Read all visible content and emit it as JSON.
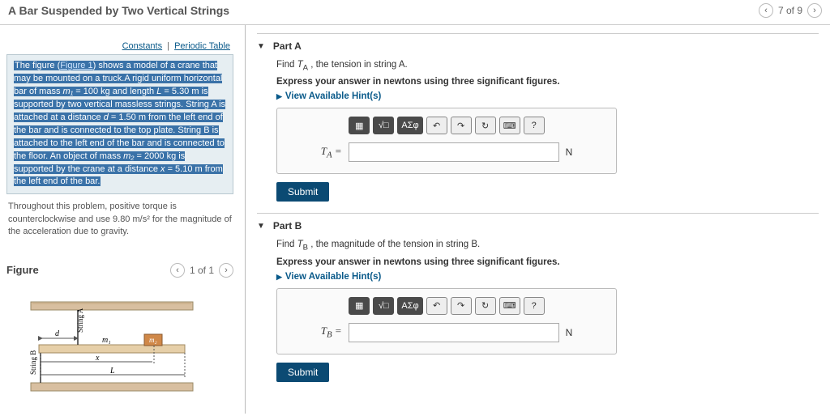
{
  "header": {
    "title": "A Bar Suspended by Two Vertical Strings",
    "pager": "7 of 9"
  },
  "left": {
    "links": {
      "constants": "Constants",
      "periodic": "Periodic Table"
    },
    "problem": {
      "pre": "The figure (",
      "figlink": "Figure 1",
      "t1a": ") shows a model of a crane that may be mounted on a truck.A rigid uniform horizontal bar of mass ",
      "m1sym": "m₁",
      "t1b": " = 100 kg and length ",
      "Lsym": "L",
      "t1c": " = 5.30 m is supported by two vertical massless strings. String A is attached at a distance ",
      "dsym": "d",
      "t1d": " = 1.50 m from the left end of the bar and is connected to the top plate. String B is attached to the left end of the bar and is connected to the floor. An object of mass ",
      "m2sym": "m₂",
      "t1e": " = 2000 kg is supported by the crane at a distance ",
      "xsym": "x",
      "t1f": " = 5.10 m from the left end of the bar."
    },
    "note": "Throughout this problem, positive torque is counterclockwise and use 9.80 m/s² for the magnitude of the acceleration due to gravity.",
    "figure": {
      "heading": "Figure",
      "pager": "1 of 1",
      "labels": {
        "stringA": "String A",
        "stringB": "String B",
        "m1": "m₁",
        "m2": "m₂",
        "d": "d",
        "x": "x",
        "L": "L"
      }
    }
  },
  "parts": {
    "A": {
      "name": "Part A",
      "prompt_pre": "Find ",
      "var": "T",
      "sub": "A",
      "prompt_post": " , the tension in string A.",
      "sig": "Express your answer in newtons using three significant figures.",
      "hints": "View Available Hint(s)",
      "toolbar": {
        "help": "?"
      },
      "ansvar": "T",
      "anssub": "A",
      "eq": " = ",
      "unit": "N",
      "submit": "Submit"
    },
    "B": {
      "name": "Part B",
      "prompt_pre": "Find ",
      "var": "T",
      "sub": "B",
      "prompt_post": " , the magnitude of the tension in string B.",
      "sig": "Express your answer in newtons using three significant figures.",
      "hints": "View Available Hint(s)",
      "toolbar": {
        "help": "?"
      },
      "ansvar": "T",
      "anssub": "B",
      "eq": " = ",
      "unit": "N",
      "submit": "Submit"
    }
  }
}
